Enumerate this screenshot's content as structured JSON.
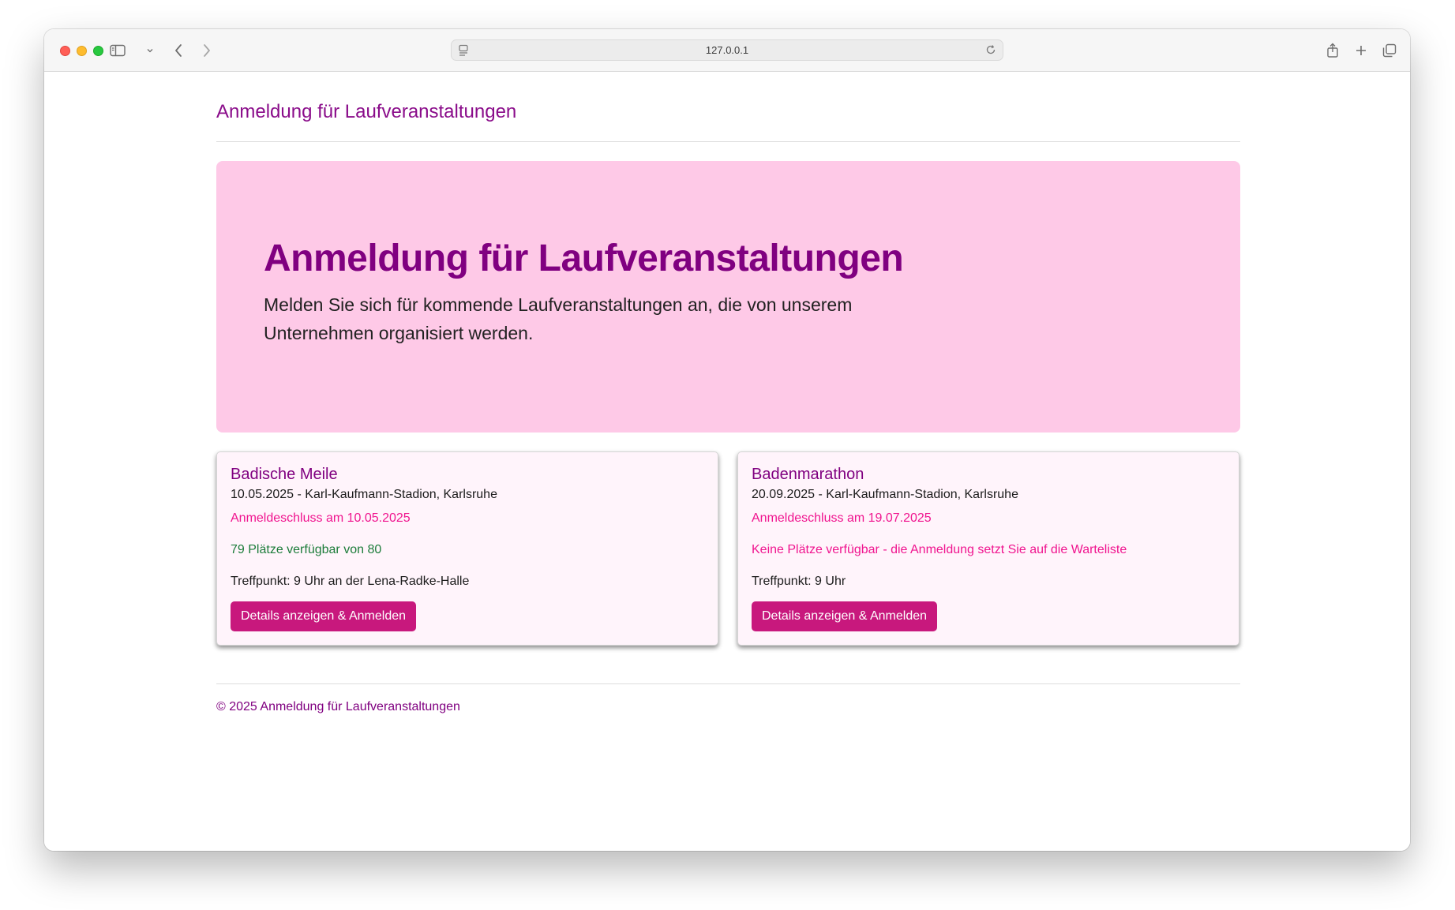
{
  "browser": {
    "url": "127.0.0.1"
  },
  "navbar": {
    "brand": "Anmeldung für Laufveranstaltungen"
  },
  "hero": {
    "title": "Anmeldung für Laufveranstaltungen",
    "lead": "Melden Sie sich für kommende Laufveranstaltungen an, die von unserem Unternehmen organisiert werden."
  },
  "events": [
    {
      "title": "Badische Meile",
      "date_location": "10.05.2025 - Karl-Kaufmann-Stadion, Karlsruhe",
      "deadline": "Anmeldeschluss am 10.05.2025",
      "seats": "79 Plätze verfügbar von 80",
      "meeting_point": "Treffpunkt: 9 Uhr an der Lena-Radke-Halle",
      "button_label": "Details anzeigen & Anmelden"
    },
    {
      "title": "Badenmarathon",
      "date_location": "20.09.2025 - Karl-Kaufmann-Stadion, Karlsruhe",
      "deadline": "Anmeldeschluss am 19.07.2025",
      "seats": "Keine Plätze verfügbar - die Anmeldung setzt Sie auf die Warteliste",
      "meeting_point": "Treffpunkt: 9 Uhr",
      "button_label": "Details anzeigen & Anmelden"
    }
  ],
  "footer": {
    "text": "© 2025 Anmeldung für Laufveranstaltungen"
  },
  "colors": {
    "brand": "#800080",
    "hero_background": "#fec9e7",
    "card_background": "#fff4fb",
    "button": "#c8187d",
    "deadline_text": "#f0158f",
    "available_text": "#1c7c3a"
  },
  "icons": {
    "sidebar": "sidebar-icon",
    "tab_overview_chevron": "chevron-down-icon",
    "back": "chevron-left-icon",
    "forward": "chevron-right-icon",
    "site_info": "page-icon",
    "reload": "reload-icon",
    "share": "share-icon",
    "new_tab": "plus-icon",
    "tabs": "tabs-icon"
  }
}
